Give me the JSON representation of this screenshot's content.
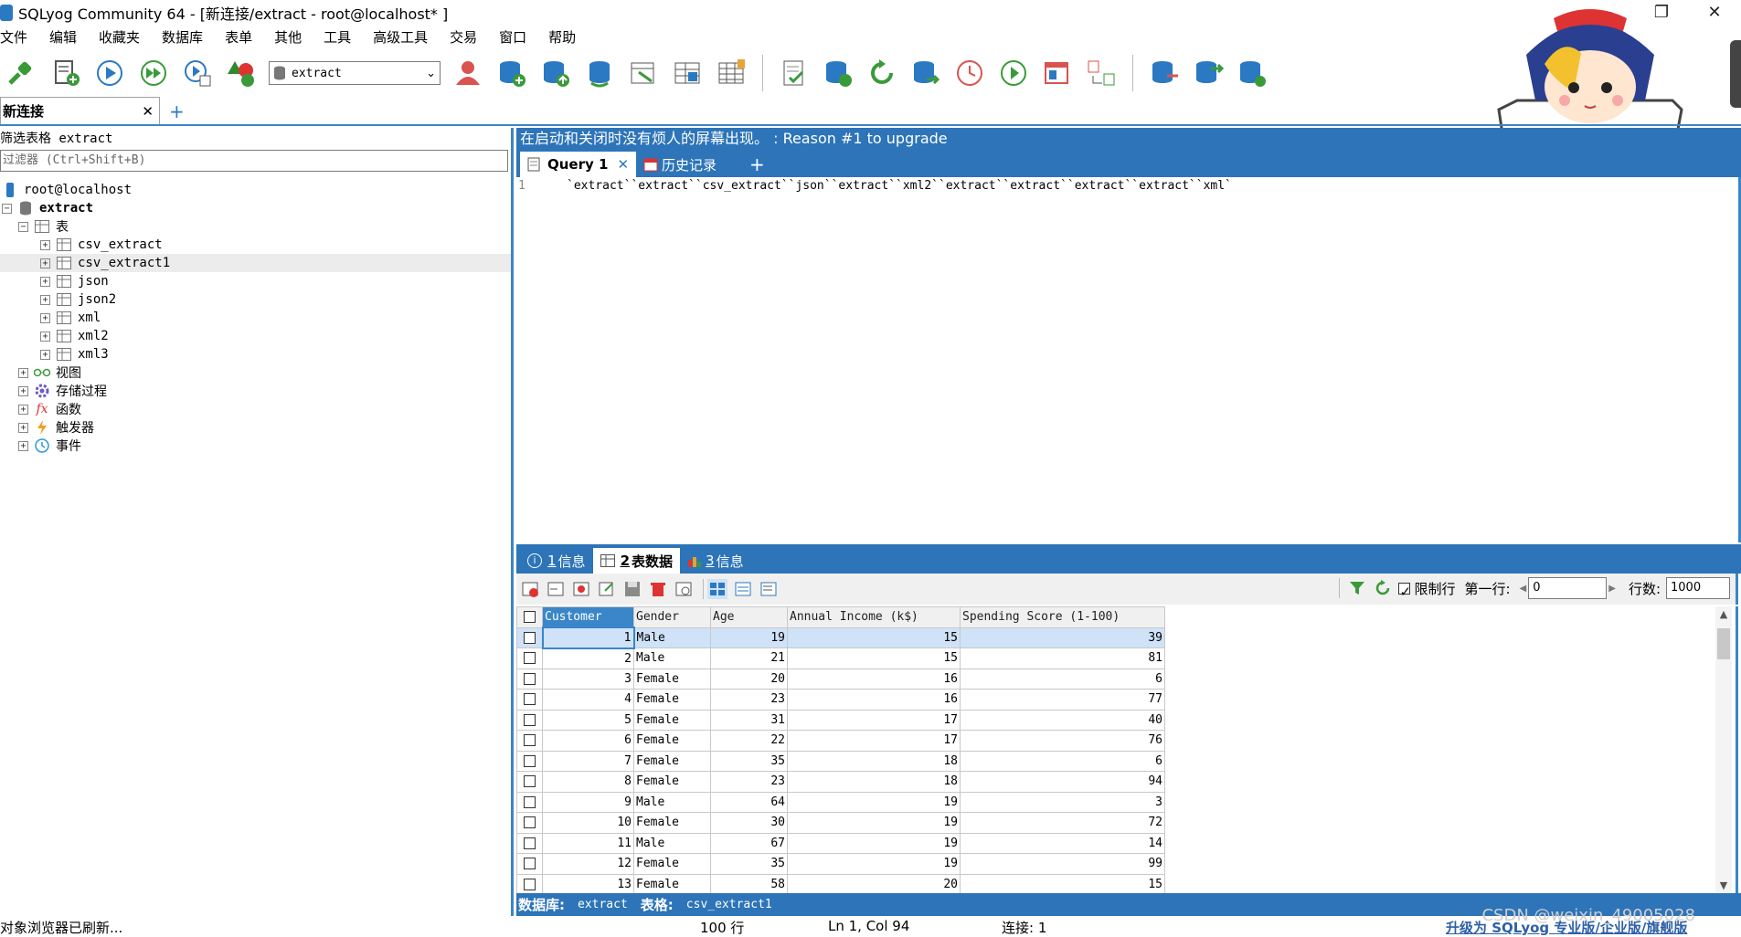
{
  "window": {
    "title": "SQLyog Community 64 - [新连接/extract - root@localhost* ]"
  },
  "menu": [
    "文件",
    "编辑",
    "收藏夹",
    "数据库",
    "表单",
    "其他",
    "工具",
    "高级工具",
    "交易",
    "窗口",
    "帮助"
  ],
  "toolbar": {
    "database_select": "extract"
  },
  "connection_tab": {
    "label": "新连接",
    "close": "✕",
    "add": "+"
  },
  "object_browser": {
    "filter_label": "筛选表格 extract",
    "filter_placeholder": "过滤器 (Ctrl+Shift+B)",
    "root": "root@localhost",
    "database": "extract",
    "tables_folder": "表",
    "tables": [
      "csv_extract",
      "csv_extract1",
      "json",
      "json2",
      "xml",
      "xml2",
      "xml3"
    ],
    "folders": [
      "视图",
      "存储过程",
      "函数",
      "触发器",
      "事件"
    ]
  },
  "banner": {
    "text": "在启动和关闭时没有烦人的屏幕出现。 : Reason #1 to upgrade"
  },
  "query_tabs": {
    "active": "Query 1",
    "close": "✕",
    "history": "历史记录",
    "add": "+"
  },
  "editor": {
    "line_number": "1",
    "code": "`extract``extract``csv_extract``json``extract``xml2``extract``extract``extract``extract``xml`"
  },
  "result_tabs": [
    {
      "num": "1",
      "label": "信息"
    },
    {
      "num": "2",
      "label": "表数据"
    },
    {
      "num": "3",
      "label": "信息"
    }
  ],
  "result_toolbar": {
    "limit_label": "限制行",
    "first_row_label": "第一行:",
    "first_row_value": "0",
    "rows_label": "行数:",
    "rows_value": "1000"
  },
  "grid": {
    "columns": [
      "Customer",
      "Gender",
      "Age",
      "Annual Income (k$)",
      "Spending Score (1-100)"
    ],
    "rows": [
      [
        "1",
        "Male",
        "19",
        "15",
        "39"
      ],
      [
        "2",
        "Male",
        "21",
        "15",
        "81"
      ],
      [
        "3",
        "Female",
        "20",
        "16",
        "6"
      ],
      [
        "4",
        "Female",
        "23",
        "16",
        "77"
      ],
      [
        "5",
        "Female",
        "31",
        "17",
        "40"
      ],
      [
        "6",
        "Female",
        "22",
        "17",
        "76"
      ],
      [
        "7",
        "Female",
        "35",
        "18",
        "6"
      ],
      [
        "8",
        "Female",
        "23",
        "18",
        "94"
      ],
      [
        "9",
        "Male",
        "64",
        "19",
        "3"
      ],
      [
        "10",
        "Female",
        "30",
        "19",
        "72"
      ],
      [
        "11",
        "Male",
        "67",
        "19",
        "14"
      ],
      [
        "12",
        "Female",
        "35",
        "19",
        "99"
      ],
      [
        "13",
        "Female",
        "58",
        "20",
        "15"
      ]
    ]
  },
  "result_status": {
    "db_label": "数据库:",
    "db_value": "extract",
    "table_label": "表格:",
    "table_value": "csv_extract1"
  },
  "statusbar": {
    "message": "对象浏览器已刷新...",
    "rows": "100 行",
    "position": "Ln 1, Col 94",
    "connections": "连接: 1",
    "upgrade": "升级为 SQLyog 专业版/企业版/旗舰版"
  },
  "watermark": "CSDN @weixin_49005028",
  "colors": {
    "accent": "#2d74b8",
    "selection": "#cfe2f7"
  }
}
